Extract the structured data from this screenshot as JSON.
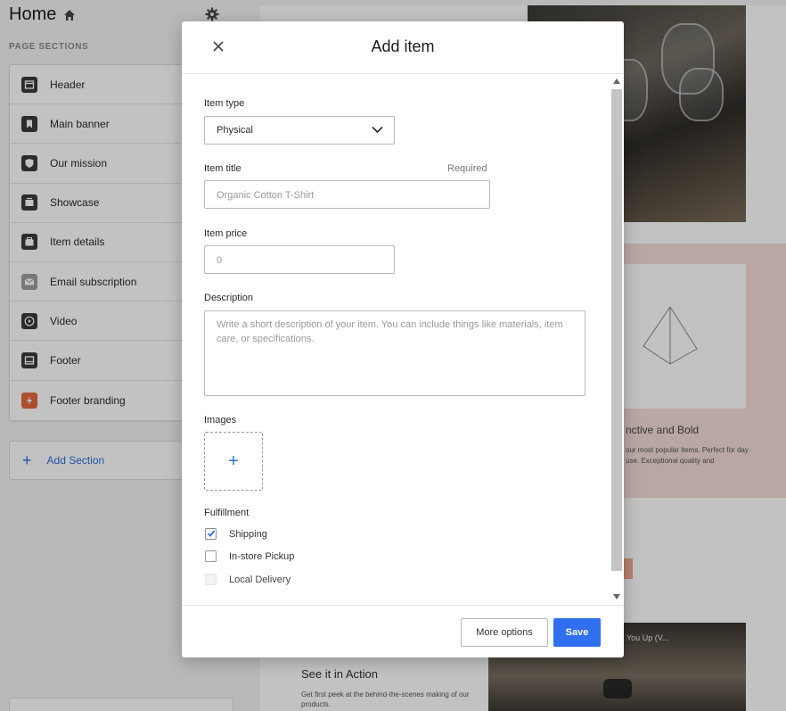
{
  "sidebar": {
    "title": "Home",
    "heading": "PAGE SECTIONS",
    "items": [
      {
        "label": "Header",
        "icon": "header-icon"
      },
      {
        "label": "Main banner",
        "icon": "bookmark-icon"
      },
      {
        "label": "Our mission",
        "icon": "shield-icon"
      },
      {
        "label": "Showcase",
        "icon": "showcase-icon"
      },
      {
        "label": "Item details",
        "icon": "item-details-icon"
      },
      {
        "label": "Email subscription",
        "icon": "envelope-icon"
      },
      {
        "label": "Video",
        "icon": "play-icon"
      },
      {
        "label": "Footer",
        "icon": "footer-icon"
      },
      {
        "label": "Footer branding",
        "icon": "lightning-icon"
      }
    ],
    "add_section_label": "Add Section"
  },
  "preview": {
    "product_title": "nctive and Bold",
    "product_desc": "our most popular items. Perfect for day use. Exceptional quality and",
    "see_title": "See it in Action",
    "see_desc": "Get first peek at the behind-the-scenes making of our products.",
    "video_title": "You Up (V..."
  },
  "modal": {
    "title": "Add item",
    "item_type_label": "Item type",
    "item_type_value": "Physical",
    "item_title_label": "Item title",
    "item_title_required": "Required",
    "item_title_placeholder": "Organic Cotton T-Shirt",
    "item_price_label": "Item price",
    "item_price_placeholder": "0",
    "description_label": "Description",
    "description_placeholder": "Write a short description of your item. You can include things like materials, item  care, or specifications.",
    "images_label": "Images",
    "images_add": "+",
    "fulfillment_label": "Fulfillment",
    "fulfillment_options": [
      {
        "label": "Shipping",
        "checked": true,
        "disabled": false
      },
      {
        "label": "In-store Pickup",
        "checked": false,
        "disabled": false
      },
      {
        "label": "Local Delivery",
        "checked": false,
        "disabled": true
      }
    ],
    "more_options_label": "More options",
    "save_label": "Save"
  },
  "colors": {
    "accent": "#2f6ff0",
    "link": "#2f6fd6",
    "branding_icon": "#e26a3e",
    "pink_band": "#f3dcd6"
  }
}
